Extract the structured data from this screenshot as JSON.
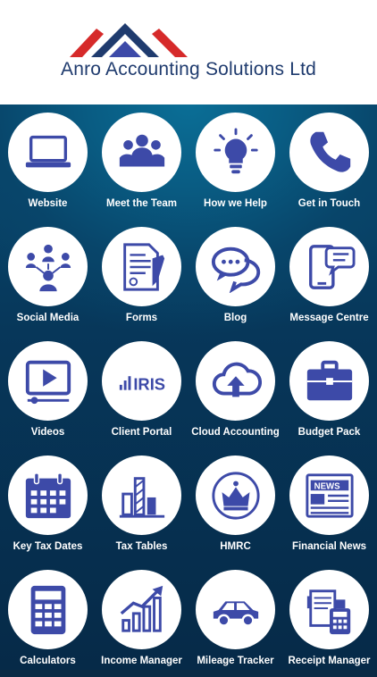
{
  "header": {
    "company_name": "Anro Accounting Solutions Ltd"
  },
  "colors": {
    "icon": "#3d4aa8",
    "logo_red": "#d62a2a",
    "logo_navy": "#1f3b6e",
    "background": "#073a5c"
  },
  "tiles": [
    {
      "label": "Website",
      "icon": "laptop-icon"
    },
    {
      "label": "Meet the Team",
      "icon": "team-icon"
    },
    {
      "label": "How we Help",
      "icon": "lightbulb-icon"
    },
    {
      "label": "Get in Touch",
      "icon": "phone-icon"
    },
    {
      "label": "Social Media",
      "icon": "social-network-icon"
    },
    {
      "label": "Forms",
      "icon": "document-pen-icon"
    },
    {
      "label": "Blog",
      "icon": "chat-bubbles-icon"
    },
    {
      "label": "Message Centre",
      "icon": "phone-message-icon"
    },
    {
      "label": "Videos",
      "icon": "video-player-icon"
    },
    {
      "label": "Client Portal",
      "icon": "iris-logo-icon",
      "icon_text": "IRIS"
    },
    {
      "label": "Cloud Accounting",
      "icon": "cloud-upload-icon"
    },
    {
      "label": "Budget Pack",
      "icon": "briefcase-icon"
    },
    {
      "label": "Key Tax Dates",
      "icon": "calendar-icon"
    },
    {
      "label": "Tax Tables",
      "icon": "bar-chart-icon"
    },
    {
      "label": "HMRC",
      "icon": "crown-icon"
    },
    {
      "label": "Financial News",
      "icon": "newspaper-icon",
      "icon_text": "NEWS"
    },
    {
      "label": "Calculators",
      "icon": "calculator-icon"
    },
    {
      "label": "Income Manager",
      "icon": "growth-chart-icon"
    },
    {
      "label": "Mileage Tracker",
      "icon": "car-icon"
    },
    {
      "label": "Receipt Manager",
      "icon": "receipt-folder-icon"
    }
  ]
}
